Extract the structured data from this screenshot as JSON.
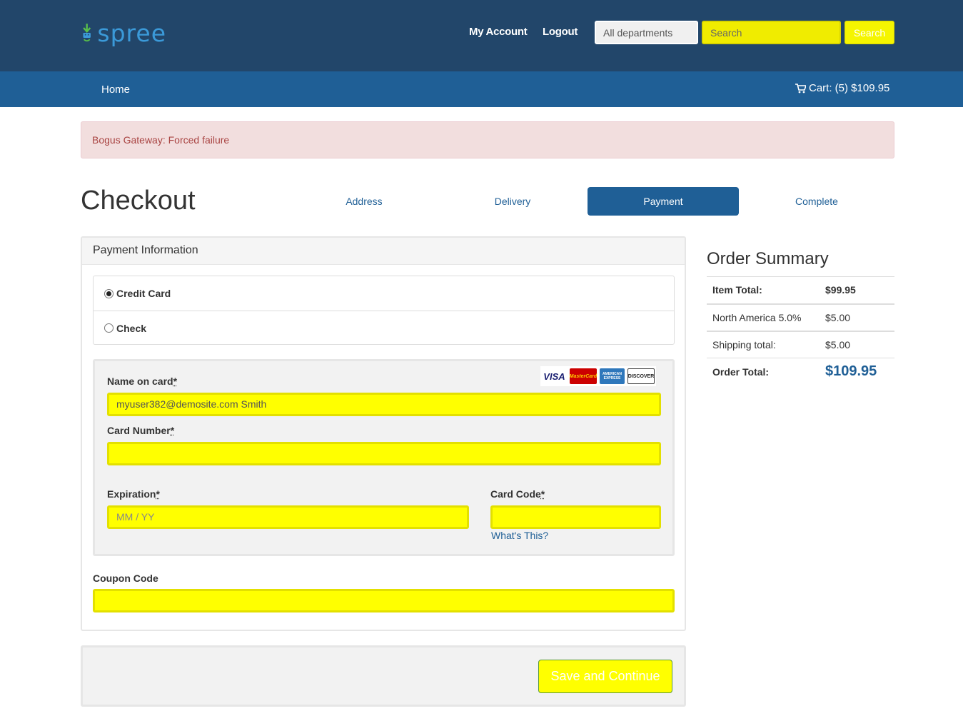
{
  "header": {
    "brand": "spree",
    "account_link": "My Account",
    "logout_link": "Logout",
    "department_select": "All departments",
    "search_placeholder": "Search",
    "search_button": "Search"
  },
  "nav": {
    "home": "Home",
    "cart": "Cart: (5) $109.95"
  },
  "alert": "Bogus Gateway: Forced failure",
  "page_title": "Checkout",
  "steps": [
    {
      "label": "Address",
      "active": false
    },
    {
      "label": "Delivery",
      "active": false
    },
    {
      "label": "Payment",
      "active": true
    },
    {
      "label": "Complete",
      "active": false
    }
  ],
  "payment": {
    "panel_title": "Payment Information",
    "methods": [
      {
        "label": "Credit Card",
        "selected": true
      },
      {
        "label": "Check",
        "selected": false
      }
    ],
    "card_logos": [
      "VISA",
      "MasterCard",
      "AMERICAN EXPRESS",
      "DISCOVER"
    ],
    "name_label": "Name on card",
    "name_value": "myuser382@demosite.com Smith",
    "number_label": "Card Number",
    "number_value": "",
    "expiration_label": "Expiration",
    "expiration_placeholder": "MM / YY",
    "code_label": "Card Code",
    "code_value": "",
    "whats_this": "What's This?",
    "required_mark": "*",
    "coupon_label": "Coupon Code",
    "coupon_value": "",
    "save_button": "Save and Continue"
  },
  "summary": {
    "title": "Order Summary",
    "rows": [
      {
        "label": "Item Total:",
        "value": "$99.95"
      },
      {
        "label": "North America 5.0%",
        "value": "$5.00"
      },
      {
        "label": "Shipping total:",
        "value": "$5.00"
      },
      {
        "label": "Order Total:",
        "value": "$109.95"
      }
    ]
  },
  "colors": {
    "header_bg": "#22466a",
    "nav_bg": "#1f5f96",
    "accent": "#1f5f96",
    "highlight": "#ffff00",
    "alert_bg": "#f2dede",
    "alert_text": "#a94442"
  }
}
